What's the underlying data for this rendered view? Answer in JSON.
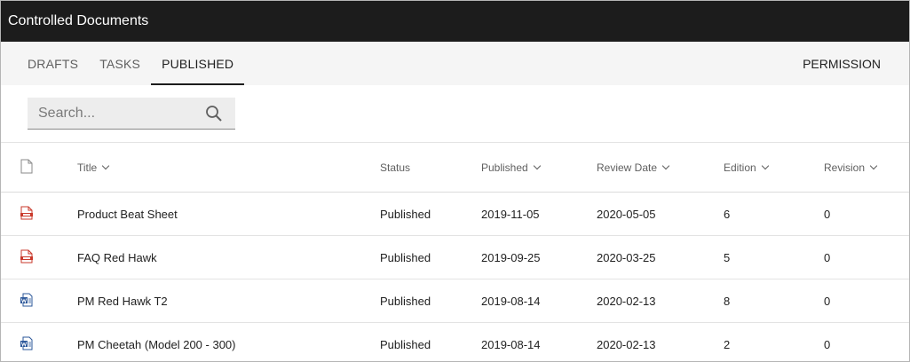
{
  "app": {
    "title": "Controlled Documents"
  },
  "tabs": [
    {
      "label": "DRAFTS",
      "active": false
    },
    {
      "label": "TASKS",
      "active": false
    },
    {
      "label": "PUBLISHED",
      "active": true
    }
  ],
  "permission_label": "PERMISSION",
  "search": {
    "placeholder": "Search...",
    "value": "",
    "icon": "search-icon"
  },
  "table": {
    "headers": {
      "title": "Title",
      "status": "Status",
      "published": "Published",
      "review_date": "Review Date",
      "edition": "Edition",
      "revision": "Revision"
    },
    "rows": [
      {
        "type": "pdf",
        "title": "Product Beat Sheet",
        "status": "Published",
        "published": "2019-11-05",
        "review_date": "2020-05-05",
        "edition": "6",
        "revision": "0"
      },
      {
        "type": "pdf",
        "title": "FAQ Red Hawk",
        "status": "Published",
        "published": "2019-09-25",
        "review_date": "2020-03-25",
        "edition": "5",
        "revision": "0"
      },
      {
        "type": "word",
        "title": "PM Red Hawk T2",
        "status": "Published",
        "published": "2019-08-14",
        "review_date": "2020-02-13",
        "edition": "8",
        "revision": "0"
      },
      {
        "type": "word",
        "title": "PM Cheetah (Model 200 - 300)",
        "status": "Published",
        "published": "2019-08-14",
        "review_date": "2020-02-13",
        "edition": "2",
        "revision": "0"
      }
    ]
  },
  "colors": {
    "titlebar": "#1c1c1c",
    "tabsbar": "#f5f5f5",
    "pdf": "#c9392b",
    "word": "#2b579a"
  }
}
